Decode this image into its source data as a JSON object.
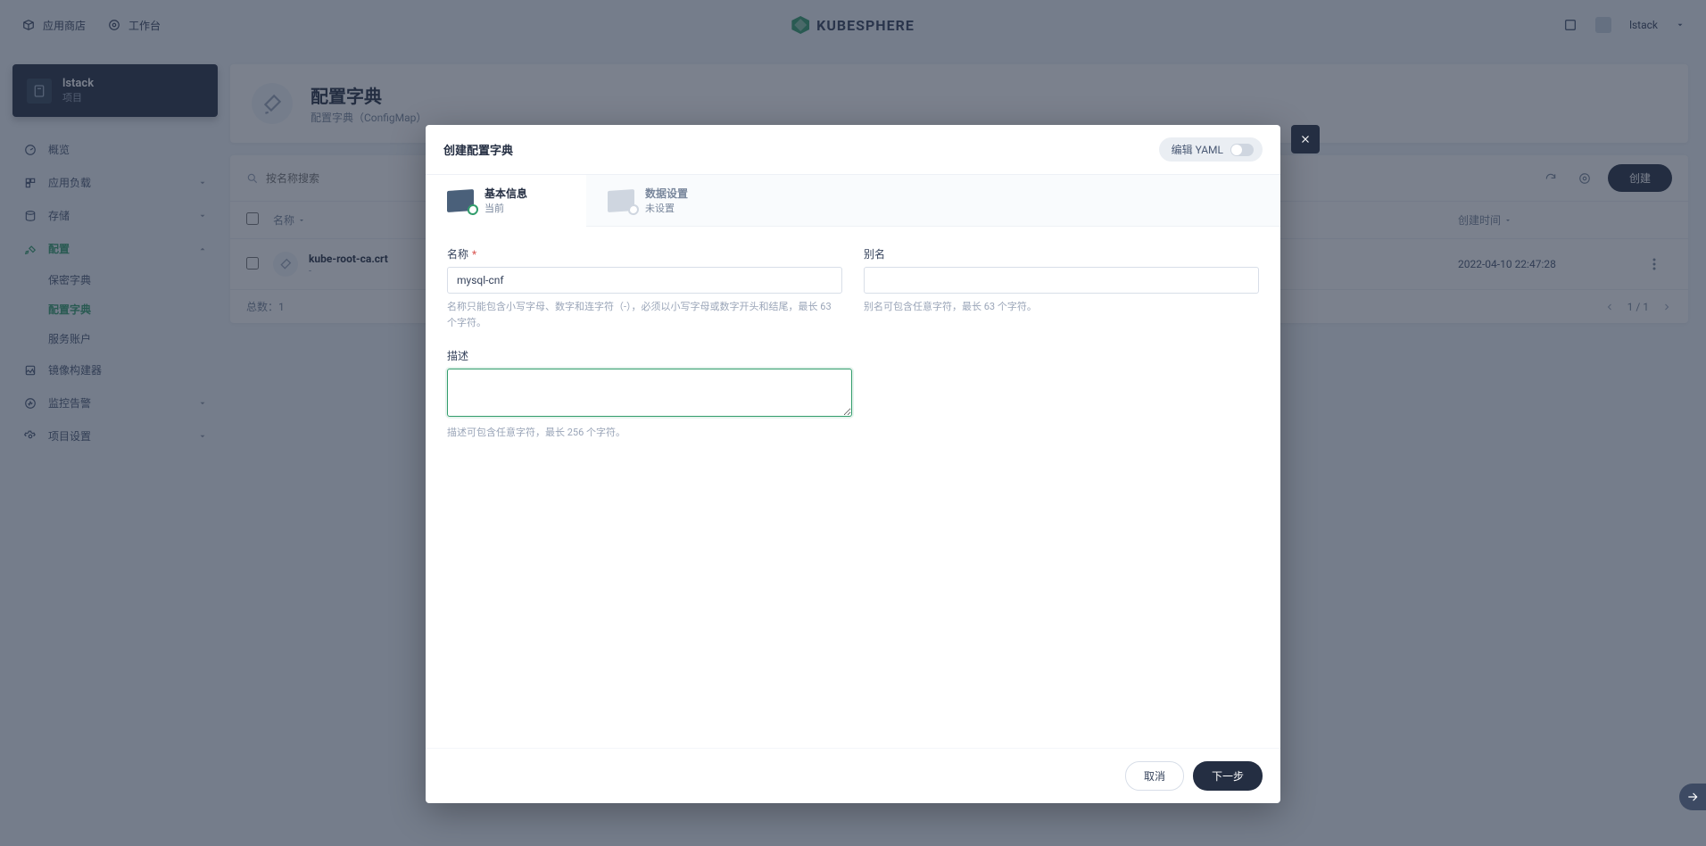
{
  "header": {
    "app_store": "应用商店",
    "workbench": "工作台",
    "brand": "KUBESPHERE",
    "user": "lstack"
  },
  "sidebar": {
    "project_name": "lstack",
    "project_sub": "项目",
    "items": [
      {
        "label": "概览"
      },
      {
        "label": "应用负载"
      },
      {
        "label": "存储"
      },
      {
        "label": "配置"
      },
      {
        "label": "镜像构建器"
      },
      {
        "label": "监控告警"
      },
      {
        "label": "项目设置"
      }
    ],
    "config_sub": [
      {
        "label": "保密字典"
      },
      {
        "label": "配置字典"
      },
      {
        "label": "服务账户"
      }
    ]
  },
  "page": {
    "title": "配置字典",
    "subtitle": "配置字典（ConfigMap）",
    "search_placeholder": "按名称搜索",
    "create_btn": "创建",
    "col_name": "名称",
    "col_time": "创建时间",
    "row_name": "kube-root-ca.crt",
    "row_sub": "-",
    "row_time": "2022-04-10 22:47:28",
    "total_label": "总数：",
    "total_value": "1",
    "page_info": "1 / 1"
  },
  "modal": {
    "title": "创建配置字典",
    "yaml_toggle": "编辑 YAML",
    "tabs": [
      {
        "title": "基本信息",
        "sub": "当前"
      },
      {
        "title": "数据设置",
        "sub": "未设置"
      }
    ],
    "form": {
      "name_label": "名称",
      "name_value": "mysql-cnf",
      "name_hint": "名称只能包含小写字母、数字和连字符（-），必须以小写字母或数字开头和结尾，最长 63 个字符。",
      "alias_label": "别名",
      "alias_hint": "别名可包含任意字符，最长 63 个字符。",
      "desc_label": "描述",
      "desc_hint": "描述可包含任意字符，最长 256 个字符。"
    },
    "cancel": "取消",
    "next": "下一步"
  }
}
